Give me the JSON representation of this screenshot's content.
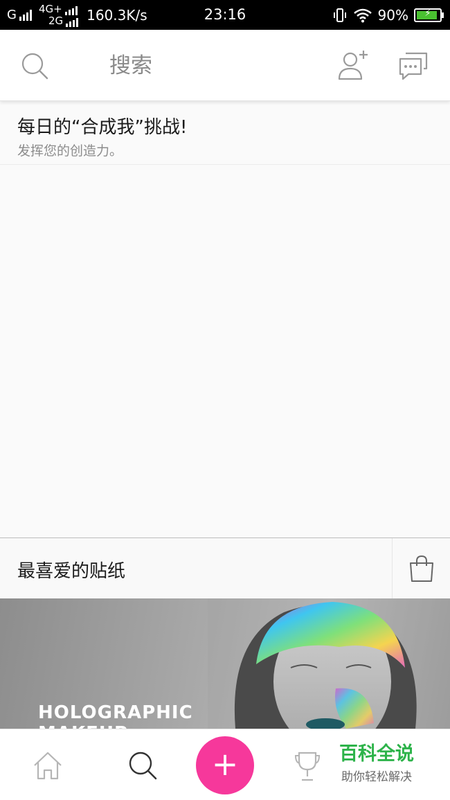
{
  "status_bar": {
    "carrier1": "G",
    "net_top": "4G+",
    "net_bottom": "2G",
    "speed": "160.3K/s",
    "time": "23:16",
    "battery_pct": "90%",
    "battery_level": 0.9
  },
  "header": {
    "search_placeholder": "搜索",
    "icons": [
      "search-icon",
      "add-user-icon",
      "chat-icon"
    ]
  },
  "challenge": {
    "title": "每日的“合成我”挑战!",
    "subtitle": "发挥您的创造力。"
  },
  "stickers": {
    "title": "最喜爱的贴纸",
    "shop_icon": "shopping-bag-icon",
    "banner_title_line1": "HOLOGRAPHIC",
    "banner_title_line2": "MAKEUP"
  },
  "bottom_nav": {
    "items": [
      "home-icon",
      "search-icon",
      "add-button",
      "trophy-icon"
    ],
    "fab_label": "+"
  },
  "watermark": {
    "main": "百科全说",
    "sub": "助你轻松解决"
  },
  "colors": {
    "accent": "#f6389b",
    "watermark_green": "#2db34a",
    "battery_green": "#49c130"
  }
}
